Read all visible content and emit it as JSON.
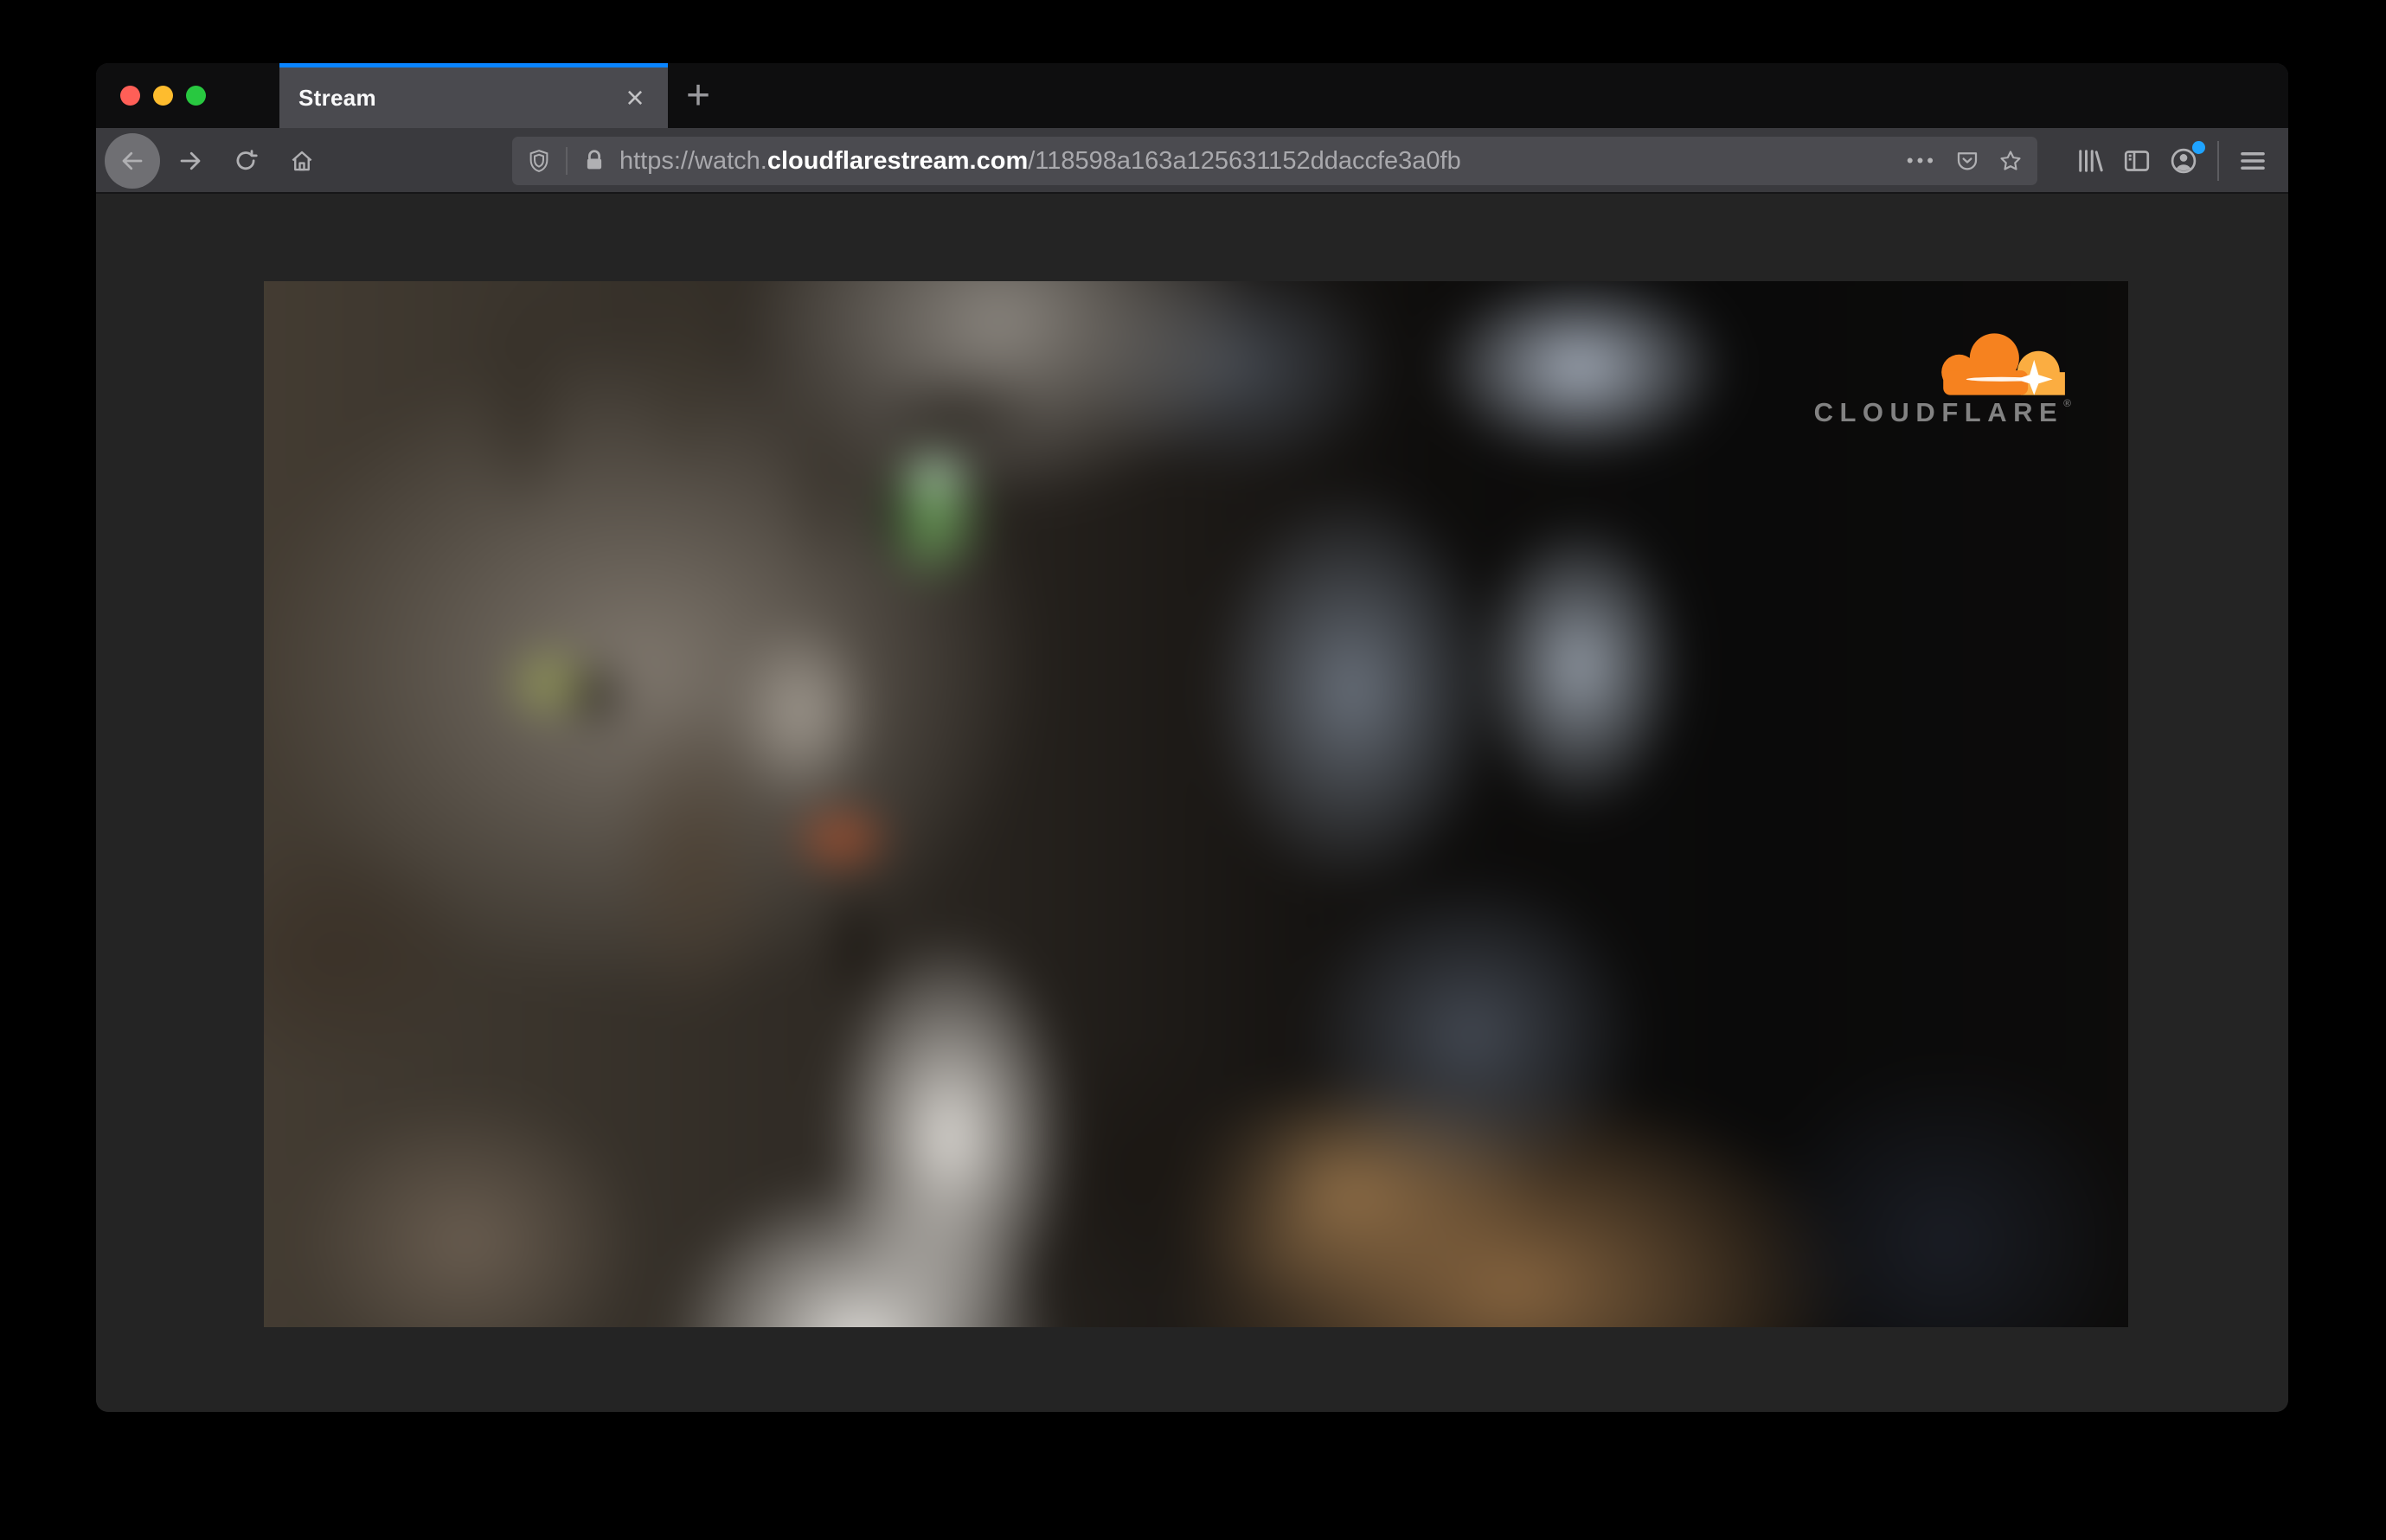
{
  "colors": {
    "accent_blue": "#0a84ff",
    "traffic_red": "#ff5f57",
    "traffic_yellow": "#febc2e",
    "traffic_green": "#28c840",
    "cloud_orange": "#f6821f",
    "cloud_orange_light": "#fbad41",
    "wordmark_gray": "#828282",
    "notification_dot_blue": "#1fa3ff"
  },
  "tab_bar": {
    "tab_title": "Stream",
    "close_tab_glyph": "×",
    "new_tab_glyph": "+"
  },
  "url_bar": {
    "url_prefix": "https://watch.",
    "url_domain": "cloudflarestream.com",
    "url_path": "/118598a163a125631152ddaccfe3a0fb",
    "page_actions_glyph": "•••"
  },
  "icons": {
    "traffic-light-close": "red circle",
    "traffic-light-minimize": "yellow circle",
    "traffic-light-zoom": "green circle",
    "back-icon": "←",
    "forward-icon": "→",
    "reload-icon": "↻",
    "home-icon": "⌂",
    "shield-icon": "tracking protection shield",
    "lock-icon": "padlock",
    "page-actions-icon": "•••",
    "pocket-icon": "save to pocket",
    "bookmark-star-icon": "☆",
    "library-icon": "library",
    "sidebar-icon": "sidebar panel",
    "account-icon": "account avatar",
    "menu-icon": "☰",
    "cloudflare-cloud-icon": "orange cloud with sparkle"
  },
  "video_player": {
    "brand_wordmark": "CLOUDFLARE",
    "brand_trademark": "®",
    "scene": "Blurred close-up of a gray tabby cat with green eyes"
  }
}
